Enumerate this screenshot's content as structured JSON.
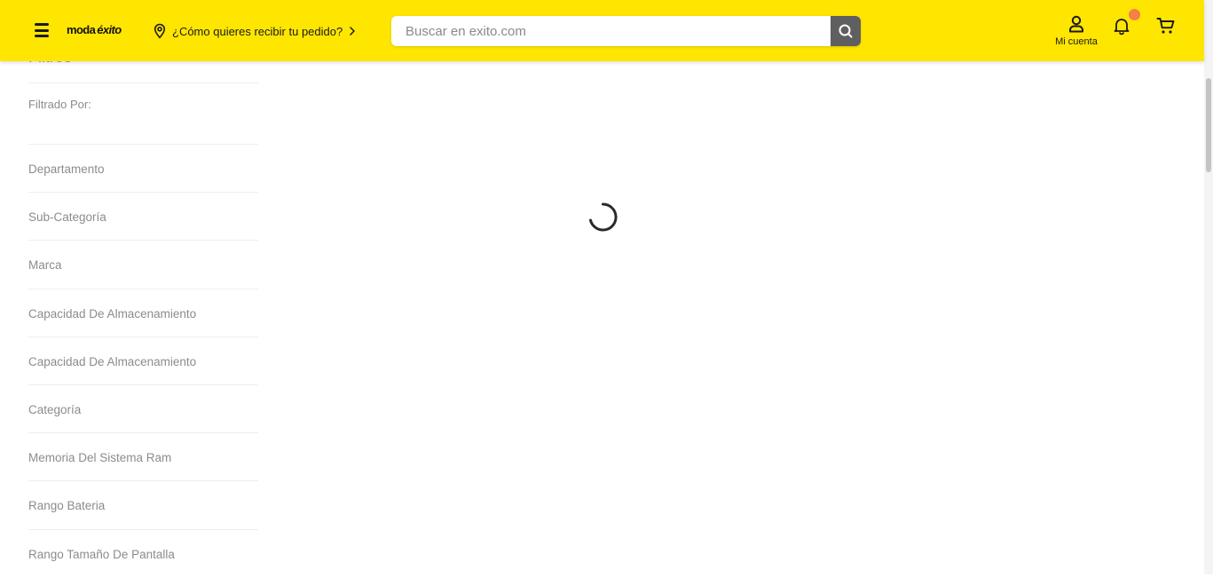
{
  "header": {
    "logo_text": "moda",
    "logo_sub": "éxito",
    "delivery_prompt": "¿Cómo quieres recibir tu pedido?",
    "search": {
      "placeholder": "Buscar en exito.com",
      "value": ""
    },
    "account_label": "Mi cuenta",
    "accent_color": "#ffe600",
    "notification_dot_color": "#f57f44"
  },
  "sidebar": {
    "title": "Filtros",
    "filtered_by_label": "Filtrado Por:",
    "facets": [
      {
        "label": "Departamento"
      },
      {
        "label": "Sub-Categoría"
      },
      {
        "label": "Marca"
      },
      {
        "label": "Capacidad De Almacenamiento"
      },
      {
        "label": "Capacidad De Almacenamiento"
      },
      {
        "label": "Categoría"
      },
      {
        "label": "Memoria Del Sistema Ram"
      },
      {
        "label": "Rango Bateria"
      },
      {
        "label": "Rango Tamaño De Pantalla"
      }
    ]
  },
  "main": {
    "state": "loading",
    "icons": [
      "loading-spinner-icon"
    ]
  }
}
